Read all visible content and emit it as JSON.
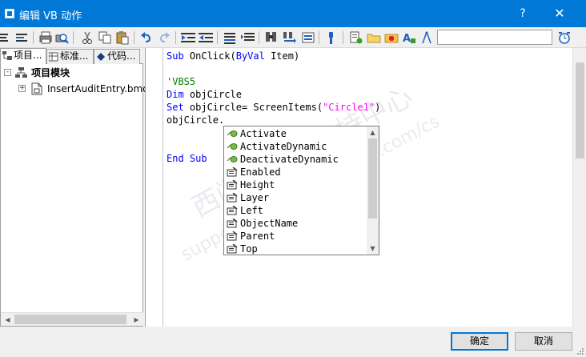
{
  "window": {
    "title": "编辑 VB 动作",
    "help_glyph": "?",
    "close_glyph": "✕"
  },
  "toolbar": {
    "icons": [
      "align-left-icon",
      "align-center-icon",
      "print-icon",
      "print-preview-icon",
      "cut-icon",
      "copy-icon",
      "paste-icon",
      "undo-icon",
      "redo-icon",
      "indent-icon",
      "outdent-icon",
      "comment-icon",
      "uncomment-icon",
      "find-icon",
      "replace-icon",
      "bookmark-icon",
      "syntax-check-icon",
      "tag-icon",
      "folder-icon",
      "function-icon",
      "property-icon",
      "clock-icon"
    ],
    "search_value": ""
  },
  "left_panel": {
    "tabs": [
      {
        "label": "项目...",
        "icon": "project-icon",
        "active": true
      },
      {
        "label": "标准...",
        "icon": "standard-icon",
        "active": false
      },
      {
        "label": "代码...",
        "icon": "code-icon",
        "active": false
      }
    ],
    "tree": [
      {
        "label": "项目模块",
        "bold": true,
        "expander": "-",
        "icon": "module-icon"
      },
      {
        "label": "InsertAuditEntry.bmo",
        "bold": false,
        "expander": "+",
        "icon": "file-icon"
      }
    ]
  },
  "editor": {
    "lines": [
      {
        "segments": [
          {
            "t": "Sub",
            "c": "kw"
          },
          {
            "t": " OnClick(",
            "c": ""
          },
          {
            "t": "ByVal",
            "c": "kw"
          },
          {
            "t": " Item)",
            "c": ""
          }
        ]
      },
      {
        "segments": []
      },
      {
        "segments": [
          {
            "t": "'VBS5",
            "c": "cm"
          }
        ]
      },
      {
        "segments": [
          {
            "t": "Dim",
            "c": "kw"
          },
          {
            "t": " objCircle",
            "c": ""
          }
        ]
      },
      {
        "segments": [
          {
            "t": "Set",
            "c": "kw"
          },
          {
            "t": " objCircle= ScreenItems(",
            "c": ""
          },
          {
            "t": "\"Circle1\"",
            "c": "str"
          },
          {
            "t": ")",
            "c": ""
          }
        ]
      },
      {
        "segments": [
          {
            "t": "objCircle.",
            "c": ""
          }
        ]
      },
      {
        "segments": []
      },
      {
        "segments": []
      },
      {
        "segments": [
          {
            "t": "End",
            "c": "kw"
          },
          {
            "t": " ",
            "c": ""
          },
          {
            "t": "Sub",
            "c": "kw"
          }
        ]
      }
    ]
  },
  "autocomplete": {
    "items": [
      {
        "label": "Activate",
        "icon": "method-icon"
      },
      {
        "label": "ActivateDynamic",
        "icon": "method-icon"
      },
      {
        "label": "DeactivateDynamic",
        "icon": "method-icon"
      },
      {
        "label": "Enabled",
        "icon": "property-icon"
      },
      {
        "label": "Height",
        "icon": "property-icon"
      },
      {
        "label": "Layer",
        "icon": "property-icon"
      },
      {
        "label": "Left",
        "icon": "property-icon"
      },
      {
        "label": "ObjectName",
        "icon": "property-icon"
      },
      {
        "label": "Parent",
        "icon": "property-icon"
      },
      {
        "label": "Top",
        "icon": "property-icon"
      }
    ]
  },
  "watermark": {
    "line1": "西门子工业支持中心",
    "line2": "support.industry.siemens.com/cs"
  },
  "footer": {
    "ok_label": "确定",
    "cancel_label": "取消"
  },
  "colors": {
    "titlebar": "#0078d7",
    "keyword": "#0000ff",
    "comment": "#008000",
    "string": "#ff00ff"
  }
}
